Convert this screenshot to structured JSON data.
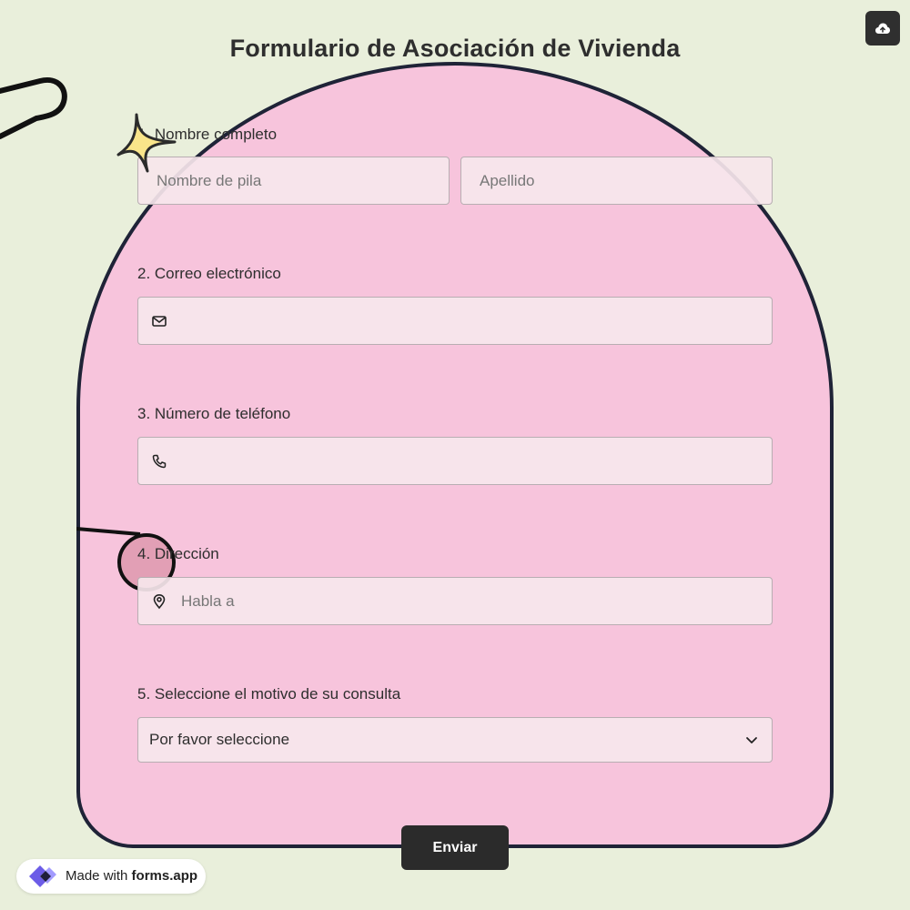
{
  "form": {
    "title": "Formulario de Asociación de Vivienda",
    "questions": [
      {
        "label": "1. Nombre completo",
        "placeholders": [
          "Nombre de pila",
          "Apellido"
        ]
      },
      {
        "label": "2. Correo electrónico",
        "placeholder": "",
        "icon": "mail-icon"
      },
      {
        "label": "3. Número de teléfono",
        "placeholder": "",
        "icon": "phone-icon"
      },
      {
        "label": "4. Dirección",
        "placeholder": "Habla a",
        "icon": "location-pin-icon"
      },
      {
        "label": "5. Seleccione el motivo de su consulta",
        "selected": "Por favor seleccione",
        "icon": "chevron-down-icon"
      }
    ],
    "submit_label": "Enviar"
  },
  "badge": {
    "prefix": "Made with ",
    "brand": "forms.app"
  },
  "colors": {
    "background": "#e9efdb",
    "arch_fill": "#f7c4dc",
    "arch_border": "#1f2337",
    "button": "#2b2b2b",
    "star": "#f9e58a"
  }
}
